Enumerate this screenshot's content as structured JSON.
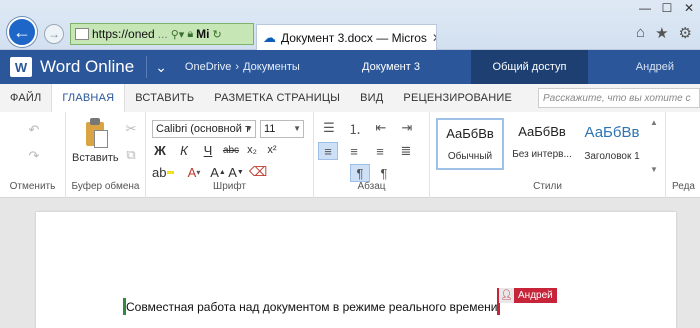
{
  "browser": {
    "url_main": "https://oned",
    "url_dim": "...",
    "site_label": "Mi",
    "tab_title": "Документ 3.docx — Micros",
    "icons": {
      "back": "arrow-left-icon",
      "forward": "arrow-right-icon",
      "search": "search-icon",
      "lock": "lock-icon",
      "refresh": "refresh-icon",
      "close": "close-icon",
      "home": "home-icon",
      "favorites": "star-icon",
      "settings": "gear-icon"
    },
    "window_controls": {
      "minimize": "—",
      "maximize": "☐",
      "close": "✕"
    }
  },
  "word": {
    "app_name": "Word Online",
    "breadcrumb": [
      "OneDrive",
      "›",
      "Документы"
    ],
    "doc_name": "Документ 3",
    "share_label": "Общий доступ",
    "user_name": "Андрей",
    "brand_color": "#2b579a"
  },
  "ribbon_tabs": [
    {
      "label": "ФАЙЛ",
      "active": false
    },
    {
      "label": "ГЛАВНАЯ",
      "active": true
    },
    {
      "label": "ВСТАВИТЬ",
      "active": false
    },
    {
      "label": "РАЗМЕТКА СТРАНИЦЫ",
      "active": false
    },
    {
      "label": "ВИД",
      "active": false
    },
    {
      "label": "РЕЦЕНЗИРОВАНИЕ",
      "active": false
    }
  ],
  "tell_me_placeholder": "Расскажите, что вы хотите с",
  "groups": {
    "undo": "Отменить",
    "clipboard": "Буфер обмена",
    "font": "Шрифт",
    "paragraph": "Абзац",
    "styles": "Стили",
    "editing_partial": "Реда"
  },
  "clipboard": {
    "paste_label": "Вставить"
  },
  "font": {
    "family": "Calibri (основной т",
    "size": "11",
    "buttons": {
      "bold": "Ж",
      "italic": "К",
      "underline": "Ч",
      "strike": "abc",
      "subscript": "x₂",
      "superscript": "x²"
    }
  },
  "styles": [
    {
      "sample": "АаБбВв",
      "name": "Обычный",
      "active": true,
      "heading": false
    },
    {
      "sample": "АаБбВв",
      "name": "Без интерв...",
      "active": false,
      "heading": false
    },
    {
      "sample": "АаБбВв",
      "name": "Заголовок 1",
      "active": false,
      "heading": true
    }
  ],
  "document": {
    "text": "Совместная работа над документом в режиме реального времени",
    "coauthor": "Андрей",
    "coauthor_color": "#c7243a",
    "own_cursor_color": "#2e8b3d"
  }
}
